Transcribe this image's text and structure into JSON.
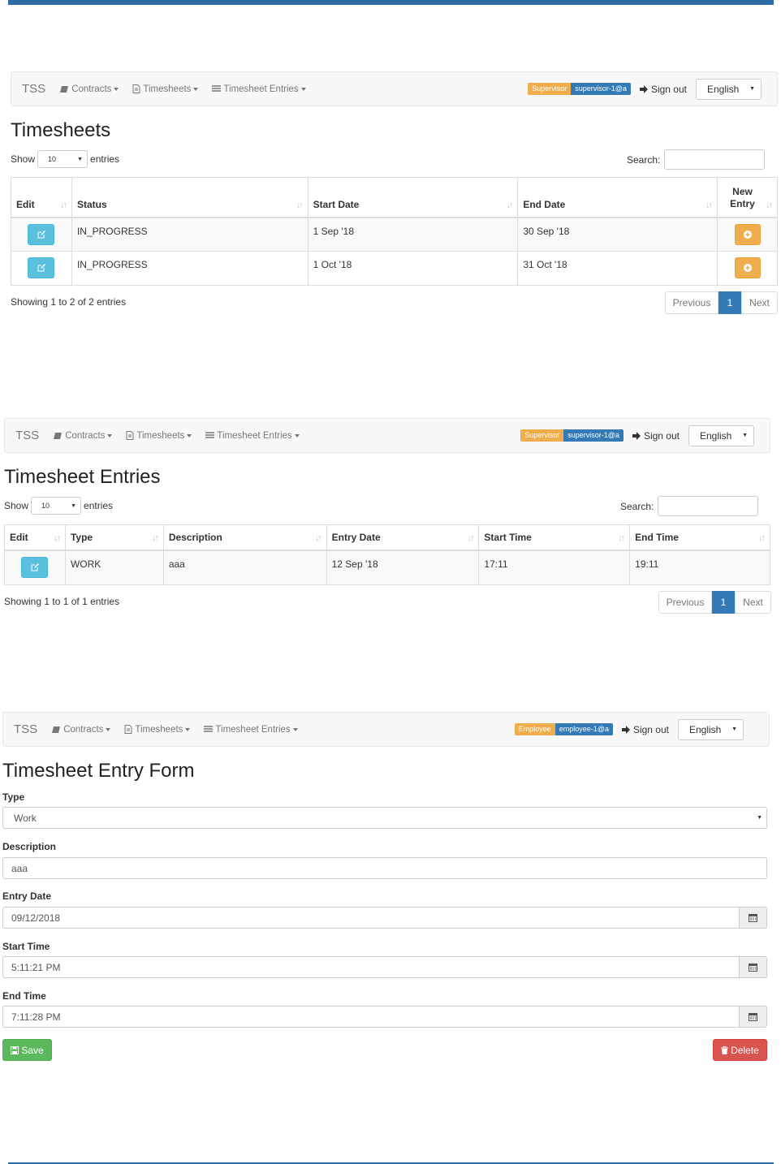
{
  "colors": {
    "accent": "#337ab7",
    "info": "#5bc0de",
    "warning": "#f0ad4e",
    "success": "#5cb85c",
    "danger": "#d9534f"
  },
  "nav_common": {
    "brand": "TSS",
    "contracts": "Contracts",
    "timesheets": "Timesheets",
    "timesheet_entries": "Timesheet Entries",
    "sign_out": "Sign out",
    "language": "English"
  },
  "panel1": {
    "role_badge": "Supervisor",
    "user_badge": "supervisor-1@a",
    "title": "Timesheets",
    "show": "Show",
    "page_length": "10",
    "entries": "entries",
    "search_label": "Search:",
    "columns": {
      "edit": "Edit",
      "status": "Status",
      "start_date": "Start Date",
      "end_date": "End Date",
      "new_entry_1": "New",
      "new_entry_2": "Entry"
    },
    "rows": [
      {
        "status": "IN_PROGRESS",
        "start_date": "1 Sep '18",
        "end_date": "30 Sep '18"
      },
      {
        "status": "IN_PROGRESS",
        "start_date": "1 Oct '18",
        "end_date": "31 Oct '18"
      }
    ],
    "info": "Showing 1 to 2 of 2 entries",
    "pager": {
      "previous": "Previous",
      "current": "1",
      "next": "Next"
    }
  },
  "panel2": {
    "role_badge": "Supervisor",
    "user_badge": "supervisor-1@a",
    "title": "Timesheet Entries",
    "show": "Show",
    "page_length": "10",
    "entries": "entries",
    "search_label": "Search:",
    "columns": {
      "edit": "Edit",
      "type": "Type",
      "description": "Description",
      "entry_date": "Entry Date",
      "start_time": "Start Time",
      "end_time": "End Time"
    },
    "rows": [
      {
        "type": "WORK",
        "description": "aaa",
        "entry_date": "12 Sep '18",
        "start_time": "17:11",
        "end_time": "19:11"
      }
    ],
    "info": "Showing 1 to 1 of 1 entries",
    "pager": {
      "previous": "Previous",
      "current": "1",
      "next": "Next"
    }
  },
  "panel3": {
    "role_badge": "Employee",
    "user_badge": "employee-1@a",
    "title": "Timesheet Entry Form",
    "fields": {
      "type_label": "Type",
      "type_value": "Work",
      "description_label": "Description",
      "description_value": "aaa",
      "entry_date_label": "Entry Date",
      "entry_date_value": "09/12/2018",
      "start_time_label": "Start Time",
      "start_time_value": "5:11:21 PM",
      "end_time_label": "End Time",
      "end_time_value": "7:11:28 PM"
    },
    "save": "Save",
    "delete": "Delete"
  },
  "icons": {
    "contracts": "book-icon",
    "timesheets": "file-icon",
    "entries": "list-icon",
    "sign_out": "log-out-icon",
    "edit": "edit-icon",
    "new": "plus-circle-icon",
    "calendar": "calendar-icon",
    "save": "floppy-icon",
    "delete": "trash-icon",
    "sort": "sort-icon"
  }
}
